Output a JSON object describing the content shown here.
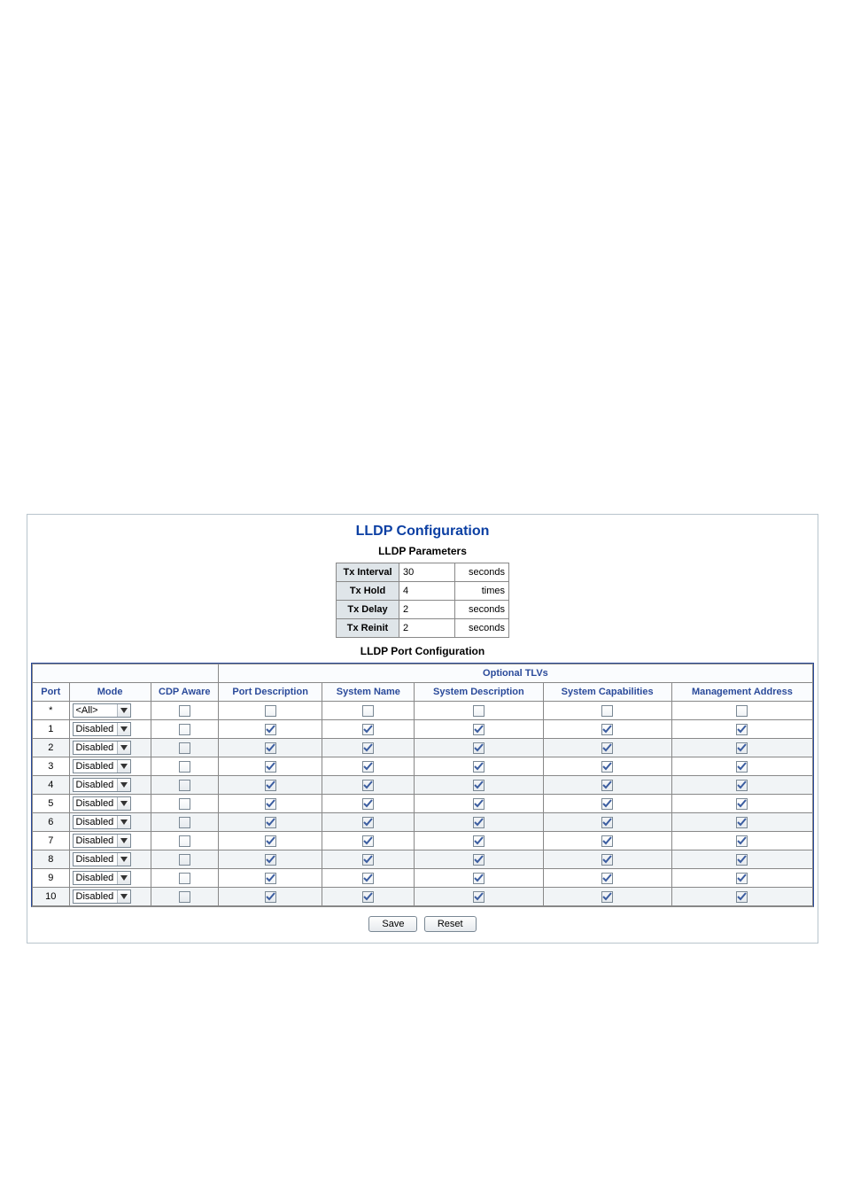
{
  "title": "LLDP Configuration",
  "params_title": "LLDP Parameters",
  "port_title": "LLDP Port Configuration",
  "optional_tlvs_header": "Optional TLVs",
  "params": [
    {
      "label": "Tx Interval",
      "value": "30",
      "unit": "seconds"
    },
    {
      "label": "Tx Hold",
      "value": "4",
      "unit": "times"
    },
    {
      "label": "Tx Delay",
      "value": "2",
      "unit": "seconds"
    },
    {
      "label": "Tx Reinit",
      "value": "2",
      "unit": "seconds"
    }
  ],
  "columns": {
    "port": "Port",
    "mode": "Mode",
    "cdp_aware": "CDP Aware",
    "port_desc": "Port Description",
    "sys_name": "System Name",
    "sys_desc": "System Description",
    "sys_cap": "System Capabilities",
    "mgmt_addr": "Management Address"
  },
  "rows": [
    {
      "port": "*",
      "mode": "<All>",
      "cdp": false,
      "pd": false,
      "sn": false,
      "sd": false,
      "sc": false,
      "ma": false
    },
    {
      "port": "1",
      "mode": "Disabled",
      "cdp": false,
      "pd": true,
      "sn": true,
      "sd": true,
      "sc": true,
      "ma": true
    },
    {
      "port": "2",
      "mode": "Disabled",
      "cdp": false,
      "pd": true,
      "sn": true,
      "sd": true,
      "sc": true,
      "ma": true
    },
    {
      "port": "3",
      "mode": "Disabled",
      "cdp": false,
      "pd": true,
      "sn": true,
      "sd": true,
      "sc": true,
      "ma": true
    },
    {
      "port": "4",
      "mode": "Disabled",
      "cdp": false,
      "pd": true,
      "sn": true,
      "sd": true,
      "sc": true,
      "ma": true
    },
    {
      "port": "5",
      "mode": "Disabled",
      "cdp": false,
      "pd": true,
      "sn": true,
      "sd": true,
      "sc": true,
      "ma": true
    },
    {
      "port": "6",
      "mode": "Disabled",
      "cdp": false,
      "pd": true,
      "sn": true,
      "sd": true,
      "sc": true,
      "ma": true
    },
    {
      "port": "7",
      "mode": "Disabled",
      "cdp": false,
      "pd": true,
      "sn": true,
      "sd": true,
      "sc": true,
      "ma": true
    },
    {
      "port": "8",
      "mode": "Disabled",
      "cdp": false,
      "pd": true,
      "sn": true,
      "sd": true,
      "sc": true,
      "ma": true
    },
    {
      "port": "9",
      "mode": "Disabled",
      "cdp": false,
      "pd": true,
      "sn": true,
      "sd": true,
      "sc": true,
      "ma": true
    },
    {
      "port": "10",
      "mode": "Disabled",
      "cdp": false,
      "pd": true,
      "sn": true,
      "sd": true,
      "sc": true,
      "ma": true
    }
  ],
  "buttons": {
    "save": "Save",
    "reset": "Reset"
  }
}
